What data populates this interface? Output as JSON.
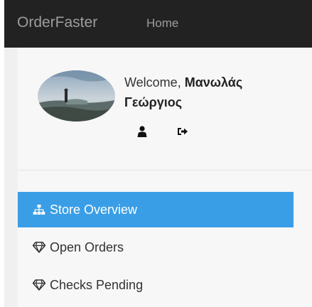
{
  "navbar": {
    "brand": "OrderFaster",
    "home_label": "Home"
  },
  "profile": {
    "welcome_prefix": "Welcome, ",
    "name_line1": "Μανωλάς",
    "name_line2": "Γεώργιος",
    "icons": [
      "user-icon",
      "sign-out-icon"
    ]
  },
  "menu": {
    "items": [
      {
        "label": "Store Overview",
        "icon": "sitemap-icon",
        "active": true
      },
      {
        "label": "Open Orders",
        "icon": "diamond-icon",
        "active": false
      },
      {
        "label": "Checks Pending",
        "icon": "diamond-icon",
        "active": false
      }
    ]
  },
  "colors": {
    "navbar_bg": "#222222",
    "navbar_text": "#9d9d9d",
    "sidebar_bg": "#f7f7f7",
    "active_bg": "#3a9ee6",
    "active_text": "#ffffff",
    "text": "#333333"
  }
}
